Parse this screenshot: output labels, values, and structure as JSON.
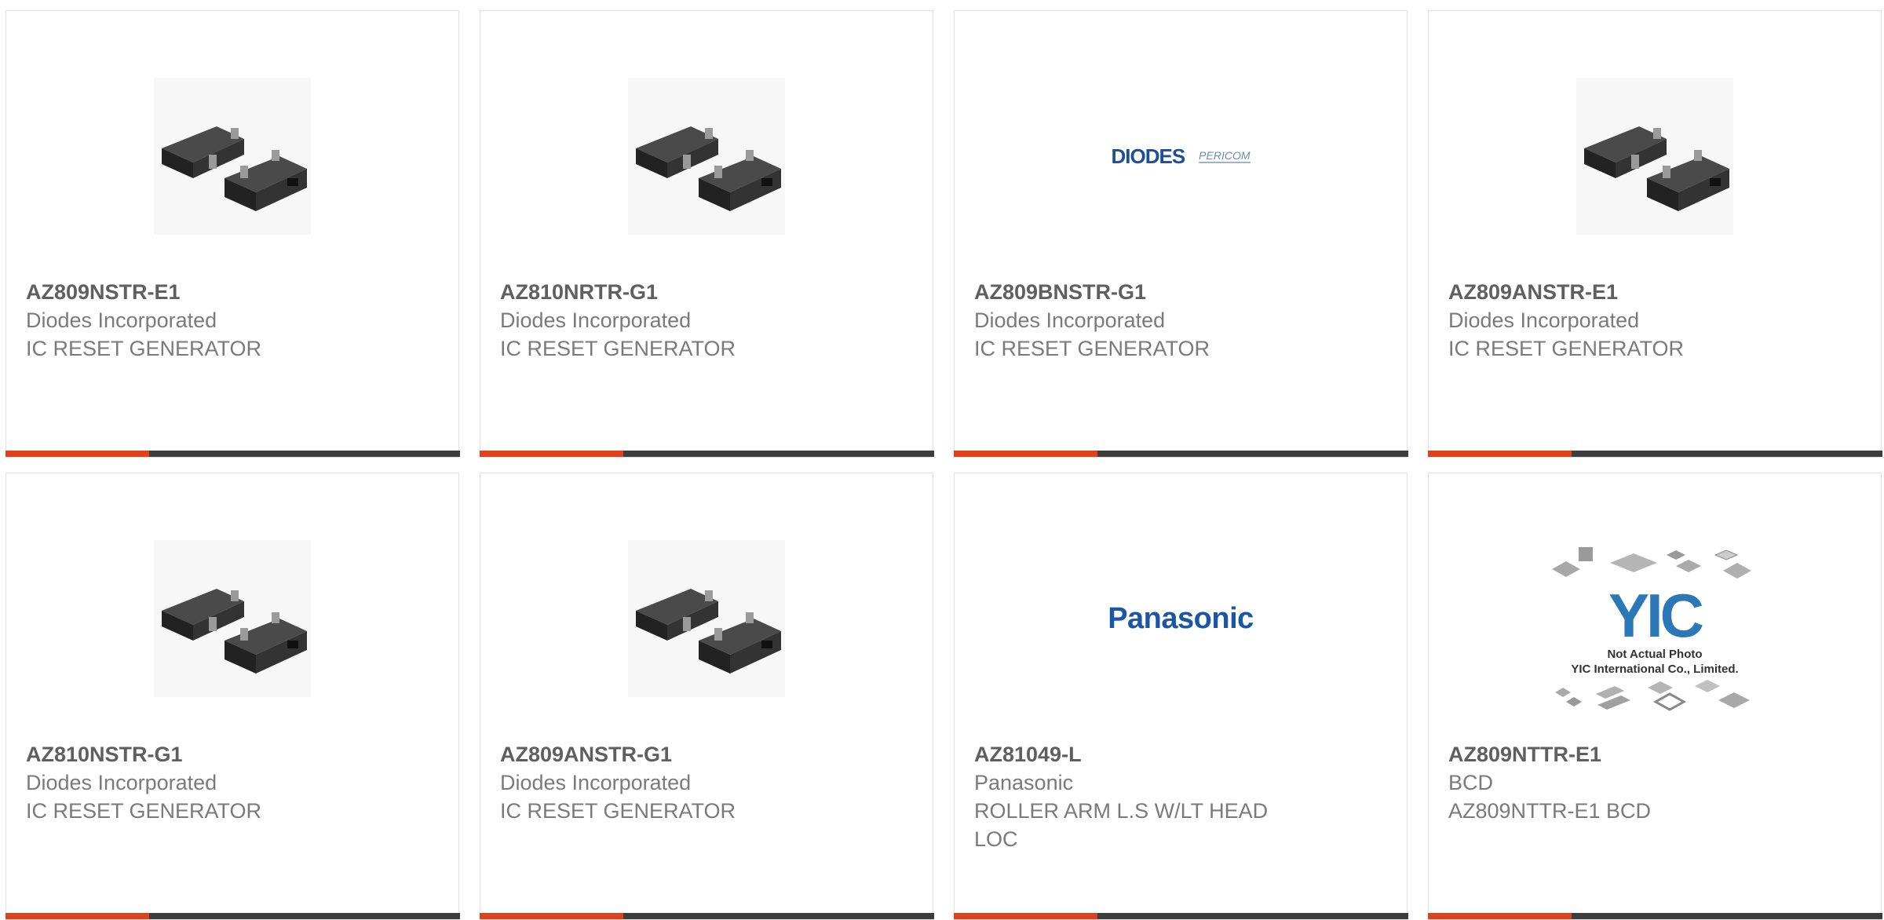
{
  "products": [
    {
      "part": "AZ809NSTR-E1",
      "manufacturer": "Diodes Incorporated",
      "description": "IC RESET GENERATOR",
      "image": "sot23-package"
    },
    {
      "part": "AZ810NRTR-G1",
      "manufacturer": "Diodes Incorporated",
      "description": "IC RESET GENERATOR",
      "image": "sot23-package"
    },
    {
      "part": "AZ809BNSTR-G1",
      "manufacturer": "Diodes Incorporated",
      "description": "IC RESET GENERATOR",
      "image": "diodes-pericom-logo",
      "logo_text": "DIODES",
      "logo_text2": "PERICOM"
    },
    {
      "part": "AZ809ANSTR-E1",
      "manufacturer": "Diodes Incorporated",
      "description": "IC RESET GENERATOR",
      "image": "sot23-package"
    },
    {
      "part": "AZ810NSTR-G1",
      "manufacturer": "Diodes Incorporated",
      "description": "IC RESET GENERATOR",
      "image": "sot23-package"
    },
    {
      "part": "AZ809ANSTR-G1",
      "manufacturer": "Diodes Incorporated",
      "description": "IC RESET GENERATOR",
      "image": "sot23-package"
    },
    {
      "part": "AZ81049-L",
      "manufacturer": "Panasonic",
      "description": "ROLLER ARM L.S W/LT HEAD LOC",
      "image": "panasonic-logo",
      "logo_text": "Panasonic"
    },
    {
      "part": "AZ809NTTR-E1",
      "manufacturer": "BCD",
      "description": "AZ809NTTR-E1 BCD",
      "image": "yic-not-actual-photo",
      "logo_text": "YIC",
      "note_line1": "Not Actual Photo",
      "note_line2": "YIC International Co., Limited."
    }
  ],
  "colors": {
    "accent": "#e0411a",
    "bar": "#3d3d3d",
    "part_text": "#5f5f5f",
    "meta_text": "#7a7a7a"
  }
}
